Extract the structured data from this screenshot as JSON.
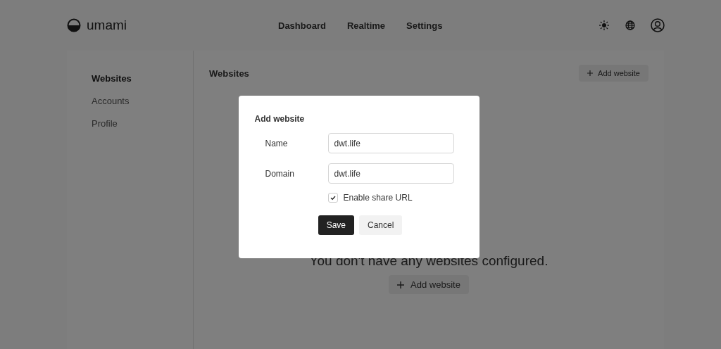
{
  "header": {
    "logo": "umami",
    "nav": [
      {
        "label": "Dashboard"
      },
      {
        "label": "Realtime"
      },
      {
        "label": "Settings"
      }
    ]
  },
  "sidebar": {
    "items": [
      {
        "label": "Websites",
        "selected": true
      },
      {
        "label": "Accounts",
        "selected": false
      },
      {
        "label": "Profile",
        "selected": false
      }
    ]
  },
  "main": {
    "title": "Websites",
    "add_button": "Add website",
    "empty_message": "You don't have any websites configured.",
    "empty_button": "Add website"
  },
  "dialog": {
    "title": "Add website",
    "fields": [
      {
        "label": "Name",
        "value": "dwt.life"
      },
      {
        "label": "Domain",
        "value": "dwt.life"
      }
    ],
    "share": {
      "label": "Enable share URL",
      "checked": true
    },
    "buttons": [
      {
        "label": "Save",
        "kind": "primary"
      },
      {
        "label": "Cancel",
        "kind": "secondary"
      }
    ]
  }
}
